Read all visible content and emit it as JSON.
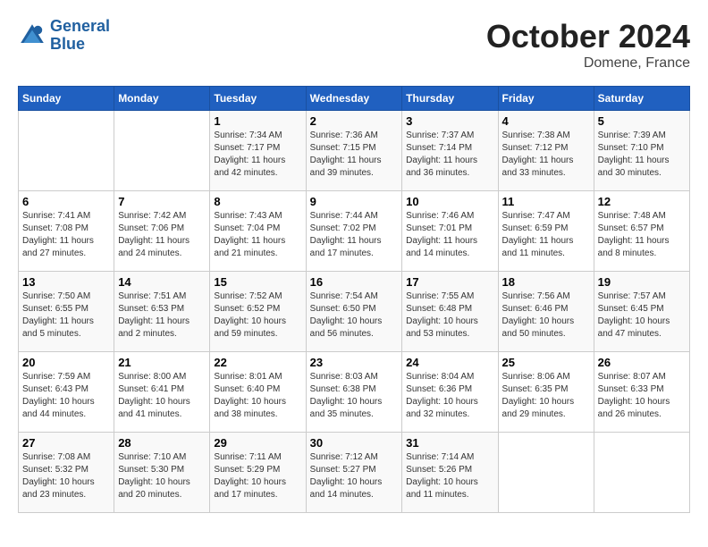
{
  "header": {
    "logo_line1": "General",
    "logo_line2": "Blue",
    "month": "October 2024",
    "location": "Domene, France"
  },
  "weekdays": [
    "Sunday",
    "Monday",
    "Tuesday",
    "Wednesday",
    "Thursday",
    "Friday",
    "Saturday"
  ],
  "weeks": [
    [
      {
        "day": null
      },
      {
        "day": null
      },
      {
        "day": "1",
        "sunrise": "Sunrise: 7:34 AM",
        "sunset": "Sunset: 7:17 PM",
        "daylight": "Daylight: 11 hours and 42 minutes."
      },
      {
        "day": "2",
        "sunrise": "Sunrise: 7:36 AM",
        "sunset": "Sunset: 7:15 PM",
        "daylight": "Daylight: 11 hours and 39 minutes."
      },
      {
        "day": "3",
        "sunrise": "Sunrise: 7:37 AM",
        "sunset": "Sunset: 7:14 PM",
        "daylight": "Daylight: 11 hours and 36 minutes."
      },
      {
        "day": "4",
        "sunrise": "Sunrise: 7:38 AM",
        "sunset": "Sunset: 7:12 PM",
        "daylight": "Daylight: 11 hours and 33 minutes."
      },
      {
        "day": "5",
        "sunrise": "Sunrise: 7:39 AM",
        "sunset": "Sunset: 7:10 PM",
        "daylight": "Daylight: 11 hours and 30 minutes."
      }
    ],
    [
      {
        "day": "6",
        "sunrise": "Sunrise: 7:41 AM",
        "sunset": "Sunset: 7:08 PM",
        "daylight": "Daylight: 11 hours and 27 minutes."
      },
      {
        "day": "7",
        "sunrise": "Sunrise: 7:42 AM",
        "sunset": "Sunset: 7:06 PM",
        "daylight": "Daylight: 11 hours and 24 minutes."
      },
      {
        "day": "8",
        "sunrise": "Sunrise: 7:43 AM",
        "sunset": "Sunset: 7:04 PM",
        "daylight": "Daylight: 11 hours and 21 minutes."
      },
      {
        "day": "9",
        "sunrise": "Sunrise: 7:44 AM",
        "sunset": "Sunset: 7:02 PM",
        "daylight": "Daylight: 11 hours and 17 minutes."
      },
      {
        "day": "10",
        "sunrise": "Sunrise: 7:46 AM",
        "sunset": "Sunset: 7:01 PM",
        "daylight": "Daylight: 11 hours and 14 minutes."
      },
      {
        "day": "11",
        "sunrise": "Sunrise: 7:47 AM",
        "sunset": "Sunset: 6:59 PM",
        "daylight": "Daylight: 11 hours and 11 minutes."
      },
      {
        "day": "12",
        "sunrise": "Sunrise: 7:48 AM",
        "sunset": "Sunset: 6:57 PM",
        "daylight": "Daylight: 11 hours and 8 minutes."
      }
    ],
    [
      {
        "day": "13",
        "sunrise": "Sunrise: 7:50 AM",
        "sunset": "Sunset: 6:55 PM",
        "daylight": "Daylight: 11 hours and 5 minutes."
      },
      {
        "day": "14",
        "sunrise": "Sunrise: 7:51 AM",
        "sunset": "Sunset: 6:53 PM",
        "daylight": "Daylight: 11 hours and 2 minutes."
      },
      {
        "day": "15",
        "sunrise": "Sunrise: 7:52 AM",
        "sunset": "Sunset: 6:52 PM",
        "daylight": "Daylight: 10 hours and 59 minutes."
      },
      {
        "day": "16",
        "sunrise": "Sunrise: 7:54 AM",
        "sunset": "Sunset: 6:50 PM",
        "daylight": "Daylight: 10 hours and 56 minutes."
      },
      {
        "day": "17",
        "sunrise": "Sunrise: 7:55 AM",
        "sunset": "Sunset: 6:48 PM",
        "daylight": "Daylight: 10 hours and 53 minutes."
      },
      {
        "day": "18",
        "sunrise": "Sunrise: 7:56 AM",
        "sunset": "Sunset: 6:46 PM",
        "daylight": "Daylight: 10 hours and 50 minutes."
      },
      {
        "day": "19",
        "sunrise": "Sunrise: 7:57 AM",
        "sunset": "Sunset: 6:45 PM",
        "daylight": "Daylight: 10 hours and 47 minutes."
      }
    ],
    [
      {
        "day": "20",
        "sunrise": "Sunrise: 7:59 AM",
        "sunset": "Sunset: 6:43 PM",
        "daylight": "Daylight: 10 hours and 44 minutes."
      },
      {
        "day": "21",
        "sunrise": "Sunrise: 8:00 AM",
        "sunset": "Sunset: 6:41 PM",
        "daylight": "Daylight: 10 hours and 41 minutes."
      },
      {
        "day": "22",
        "sunrise": "Sunrise: 8:01 AM",
        "sunset": "Sunset: 6:40 PM",
        "daylight": "Daylight: 10 hours and 38 minutes."
      },
      {
        "day": "23",
        "sunrise": "Sunrise: 8:03 AM",
        "sunset": "Sunset: 6:38 PM",
        "daylight": "Daylight: 10 hours and 35 minutes."
      },
      {
        "day": "24",
        "sunrise": "Sunrise: 8:04 AM",
        "sunset": "Sunset: 6:36 PM",
        "daylight": "Daylight: 10 hours and 32 minutes."
      },
      {
        "day": "25",
        "sunrise": "Sunrise: 8:06 AM",
        "sunset": "Sunset: 6:35 PM",
        "daylight": "Daylight: 10 hours and 29 minutes."
      },
      {
        "day": "26",
        "sunrise": "Sunrise: 8:07 AM",
        "sunset": "Sunset: 6:33 PM",
        "daylight": "Daylight: 10 hours and 26 minutes."
      }
    ],
    [
      {
        "day": "27",
        "sunrise": "Sunrise: 7:08 AM",
        "sunset": "Sunset: 5:32 PM",
        "daylight": "Daylight: 10 hours and 23 minutes."
      },
      {
        "day": "28",
        "sunrise": "Sunrise: 7:10 AM",
        "sunset": "Sunset: 5:30 PM",
        "daylight": "Daylight: 10 hours and 20 minutes."
      },
      {
        "day": "29",
        "sunrise": "Sunrise: 7:11 AM",
        "sunset": "Sunset: 5:29 PM",
        "daylight": "Daylight: 10 hours and 17 minutes."
      },
      {
        "day": "30",
        "sunrise": "Sunrise: 7:12 AM",
        "sunset": "Sunset: 5:27 PM",
        "daylight": "Daylight: 10 hours and 14 minutes."
      },
      {
        "day": "31",
        "sunrise": "Sunrise: 7:14 AM",
        "sunset": "Sunset: 5:26 PM",
        "daylight": "Daylight: 10 hours and 11 minutes."
      },
      {
        "day": null
      },
      {
        "day": null
      }
    ]
  ]
}
